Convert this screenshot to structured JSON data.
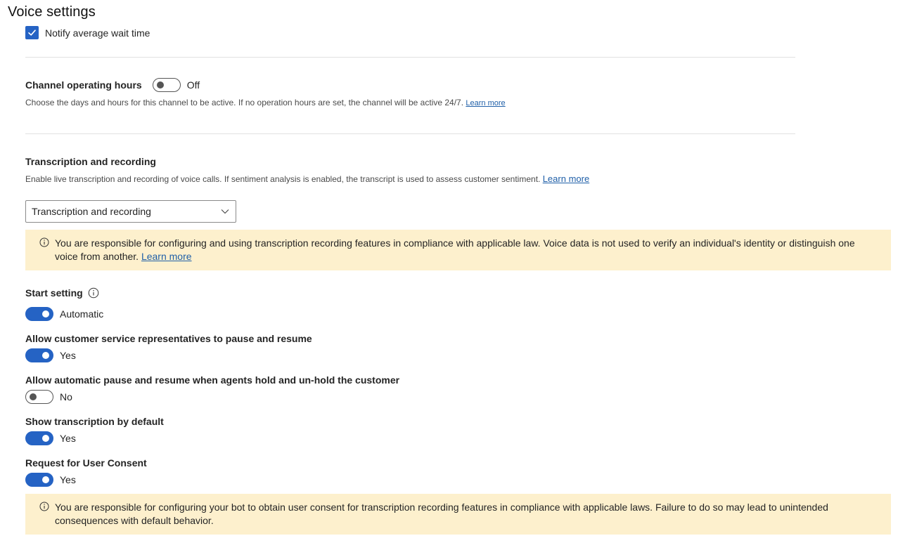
{
  "page": {
    "title": "Voice settings"
  },
  "notify": {
    "label": "Notify average wait time",
    "checked": true
  },
  "operating_hours": {
    "label": "Channel operating hours",
    "state": "Off",
    "description": "Choose the days and hours for this channel to be active. If no operation hours are set, the channel will be active 24/7.",
    "link": "Learn more"
  },
  "transcription": {
    "label": "Transcription and recording",
    "description": "Enable live transcription and recording of voice calls. If sentiment analysis is enabled, the transcript is used to assess customer sentiment.",
    "link": "Learn more",
    "dropdown_value": "Transcription and recording",
    "banner_text": "You are responsible for configuring and using transcription recording features in compliance with applicable law. Voice data is not used to verify an individual's identity or distinguish one voice from another.",
    "banner_link": "Learn more"
  },
  "settings": [
    {
      "label": "Start setting",
      "state": "Automatic",
      "on": true
    },
    {
      "label": "Allow customer service representatives to pause and resume",
      "state": "Yes",
      "on": true
    },
    {
      "label": "Allow automatic pause and resume when agents hold and un-hold the customer",
      "state": "No",
      "on": false
    },
    {
      "label": "Show transcription by default",
      "state": "Yes",
      "on": true
    },
    {
      "label": "Request for User Consent",
      "state": "Yes",
      "on": true
    }
  ],
  "consent_banner": {
    "text": "You are responsible for configuring your bot to obtain user consent for transcription recording features in compliance with applicable laws. Failure to do so may lead to unintended consequences with default behavior."
  },
  "colors": {
    "accent": "#2563c4",
    "warning_bg": "#fdf0cd",
    "link": "#1f5fa8"
  },
  "icons": [
    "checkmark-icon",
    "info-icon",
    "chevron-down-icon"
  ]
}
